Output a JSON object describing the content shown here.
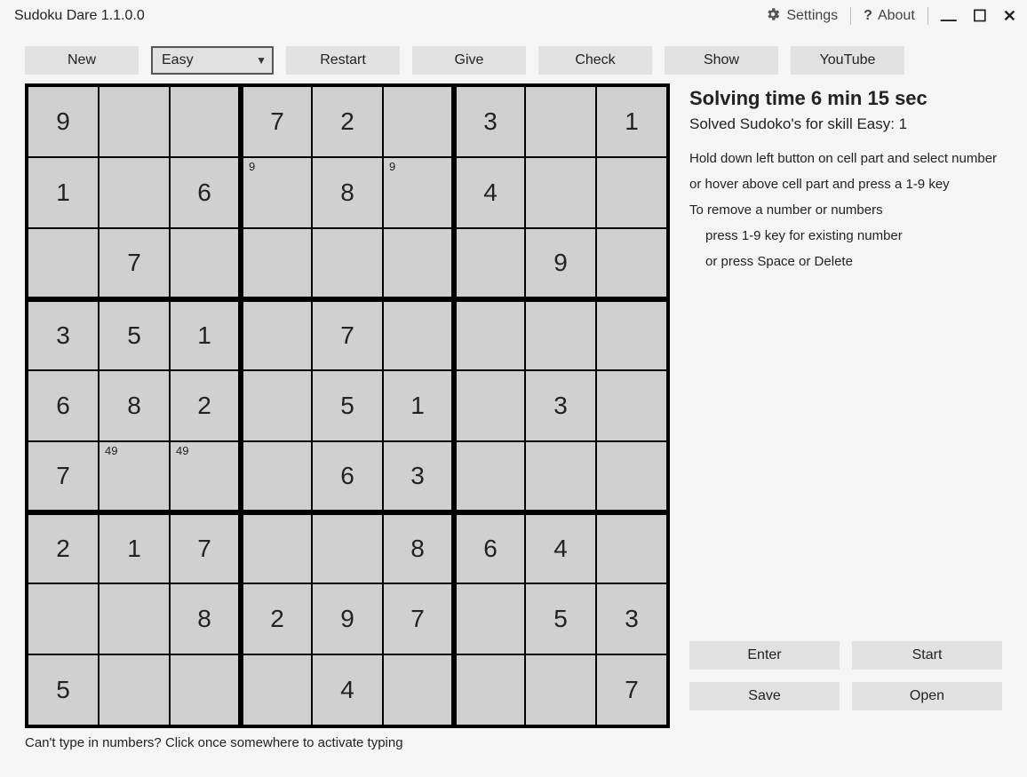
{
  "window": {
    "title": "Sudoku Dare 1.1.0.0",
    "settings": "Settings",
    "about": "About"
  },
  "toolbar": {
    "new": "New",
    "difficulty_selected": "Easy",
    "restart": "Restart",
    "give": "Give",
    "check": "Check",
    "show": "Show",
    "youtube": "YouTube"
  },
  "side": {
    "timer": "Solving time 6 min 15 sec",
    "solved": "Solved Sudoko's for skill Easy: 1",
    "help1": "Hold down left button on cell part and select number",
    "help2": "or hover above cell part and press a 1-9 key",
    "help3": "To remove a number or numbers",
    "help4": "press 1-9 key for existing number",
    "help5": "or press Space or Delete",
    "enter": "Enter",
    "start": "Start",
    "save": "Save",
    "open": "Open"
  },
  "footer": {
    "hint": "Can't type in numbers? Click once somewhere to activate typing"
  },
  "board": {
    "rows": [
      [
        {
          "v": "9"
        },
        {
          "v": ""
        },
        {
          "v": ""
        },
        {
          "v": "7"
        },
        {
          "v": "2"
        },
        {
          "v": ""
        },
        {
          "v": "3"
        },
        {
          "v": ""
        },
        {
          "v": "1"
        }
      ],
      [
        {
          "v": "1"
        },
        {
          "v": ""
        },
        {
          "v": "6"
        },
        {
          "v": "",
          "n": "9"
        },
        {
          "v": "8"
        },
        {
          "v": "",
          "n": "9"
        },
        {
          "v": "4"
        },
        {
          "v": ""
        },
        {
          "v": ""
        }
      ],
      [
        {
          "v": ""
        },
        {
          "v": "7"
        },
        {
          "v": ""
        },
        {
          "v": ""
        },
        {
          "v": ""
        },
        {
          "v": ""
        },
        {
          "v": ""
        },
        {
          "v": "9"
        },
        {
          "v": ""
        }
      ],
      [
        {
          "v": "3"
        },
        {
          "v": "5"
        },
        {
          "v": "1"
        },
        {
          "v": ""
        },
        {
          "v": "7"
        },
        {
          "v": ""
        },
        {
          "v": ""
        },
        {
          "v": ""
        },
        {
          "v": ""
        }
      ],
      [
        {
          "v": "6"
        },
        {
          "v": "8"
        },
        {
          "v": "2"
        },
        {
          "v": ""
        },
        {
          "v": "5"
        },
        {
          "v": "1"
        },
        {
          "v": ""
        },
        {
          "v": "3"
        },
        {
          "v": ""
        }
      ],
      [
        {
          "v": "7"
        },
        {
          "v": "",
          "n": "49"
        },
        {
          "v": "",
          "n": "49"
        },
        {
          "v": ""
        },
        {
          "v": "6"
        },
        {
          "v": "3"
        },
        {
          "v": ""
        },
        {
          "v": ""
        },
        {
          "v": ""
        }
      ],
      [
        {
          "v": "2"
        },
        {
          "v": "1"
        },
        {
          "v": "7"
        },
        {
          "v": ""
        },
        {
          "v": ""
        },
        {
          "v": "8"
        },
        {
          "v": "6"
        },
        {
          "v": "4"
        },
        {
          "v": ""
        }
      ],
      [
        {
          "v": ""
        },
        {
          "v": ""
        },
        {
          "v": "8"
        },
        {
          "v": "2"
        },
        {
          "v": "9"
        },
        {
          "v": "7"
        },
        {
          "v": ""
        },
        {
          "v": "5"
        },
        {
          "v": "3"
        }
      ],
      [
        {
          "v": "5"
        },
        {
          "v": ""
        },
        {
          "v": ""
        },
        {
          "v": ""
        },
        {
          "v": "4"
        },
        {
          "v": ""
        },
        {
          "v": ""
        },
        {
          "v": ""
        },
        {
          "v": "7"
        }
      ]
    ]
  }
}
